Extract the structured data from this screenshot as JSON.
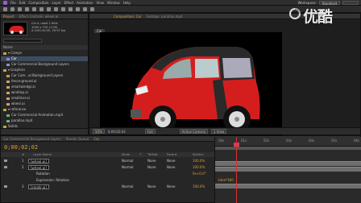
{
  "menu": [
    "File",
    "Edit",
    "Composition",
    "Layer",
    "Effect",
    "Animation",
    "View",
    "Window",
    "Help"
  ],
  "workspace": {
    "label": "Workspace:",
    "value": "Standard"
  },
  "watermark": "优酷",
  "project": {
    "tabs": [
      "Project",
      "Effect Controls: wheel.ai"
    ],
    "item_name": "Car ▾, used 1 time",
    "item_info": [
      "1000 x 720 (1.00)",
      "Δ 0;00;10;00, 29.97 fps"
    ],
    "column_header": "Name",
    "items": [
      {
        "label": "▾ Comps",
        "color": "#c8a040",
        "sel": false,
        "indent": 0
      },
      {
        "label": "Car",
        "color": "#8a8fd0",
        "sel": true,
        "indent": 4
      },
      {
        "label": "Car Commercial Background Layers",
        "color": "#8a8fd0",
        "sel": false,
        "indent": 4
      },
      {
        "label": "▾ Graphics",
        "color": "#c8a040",
        "sel": false,
        "indent": 0
      },
      {
        "label": "Car Com...al Background Layers",
        "color": "#c8a040",
        "sel": false,
        "indent": 4
      },
      {
        "label": "fence-ground.ai",
        "color": "#d0a070",
        "sel": false,
        "indent": 4
      },
      {
        "label": "smartwindgr.ai",
        "color": "#d0a070",
        "sel": false,
        "indent": 4
      },
      {
        "label": "windrop.ai",
        "color": "#d0a070",
        "sel": false,
        "indent": 4
      },
      {
        "label": "smalliner.ai",
        "color": "#d0a070",
        "sel": false,
        "indent": 4
      },
      {
        "label": "wheel.ai",
        "color": "#d0a070",
        "sel": false,
        "indent": 4
      },
      {
        "label": "▾ reference",
        "color": "#c8a040",
        "sel": false,
        "indent": 0
      },
      {
        "label": "Car Commercial Animation.mp4",
        "color": "#70b070",
        "sel": false,
        "indent": 4
      },
      {
        "label": "parallax.mp4",
        "color": "#70b070",
        "sel": false,
        "indent": 4
      },
      {
        "label": "Solids",
        "color": "#c8a040",
        "sel": false,
        "indent": 0
      }
    ]
  },
  "viewer": {
    "tabs": [
      "Composition: Car",
      "Footage: parallax.mp4"
    ],
    "comp_chip": "Car",
    "toolbar": {
      "zoom": "50%",
      "timecode": "0;00;02;02",
      "resolution": "Full",
      "camera": "Active Camera",
      "views": "1 View"
    }
  },
  "timeline": {
    "tabs": [
      "Car Commercial Background Layers",
      "Render Queue",
      "Car"
    ],
    "current_time": "0;00;02;02",
    "columns": [
      "#",
      "Layer Name",
      "Mode",
      "T",
      "TrkMat",
      "Parent",
      "Stretch"
    ],
    "rows": [
      {
        "num": "1",
        "name": "[wheel.ai]",
        "boxed": true,
        "mode": "Normal",
        "trkmat": "None",
        "parent": "None",
        "stretch": "100.0%",
        "orange": false
      },
      {
        "num": "2",
        "name": "[wheel.ai]",
        "boxed": true,
        "mode": "Normal",
        "trkmat": "None",
        "parent": "None",
        "stretch": "100.0%",
        "orange": false
      },
      {
        "num": "",
        "name": "Rotation",
        "boxed": false,
        "mode": "",
        "trkmat": "",
        "parent": "",
        "stretch": "0x+0.0°",
        "orange": true
      },
      {
        "num": "",
        "name": "Expression: Rotation",
        "boxed": false,
        "mode": "",
        "trkmat": "",
        "parent": "",
        "stretch": "",
        "orange": false
      },
      {
        "num": "3",
        "name": "[smallr.ai]",
        "boxed": true,
        "mode": "Normal",
        "trkmat": "None",
        "parent": "None",
        "stretch": "100.0%",
        "orange": false
      }
    ],
    "ruler_ticks": [
      "00s",
      "01s",
      "02s",
      "03s",
      "04s",
      "05s",
      "06s"
    ],
    "expression_text": "time*360"
  }
}
